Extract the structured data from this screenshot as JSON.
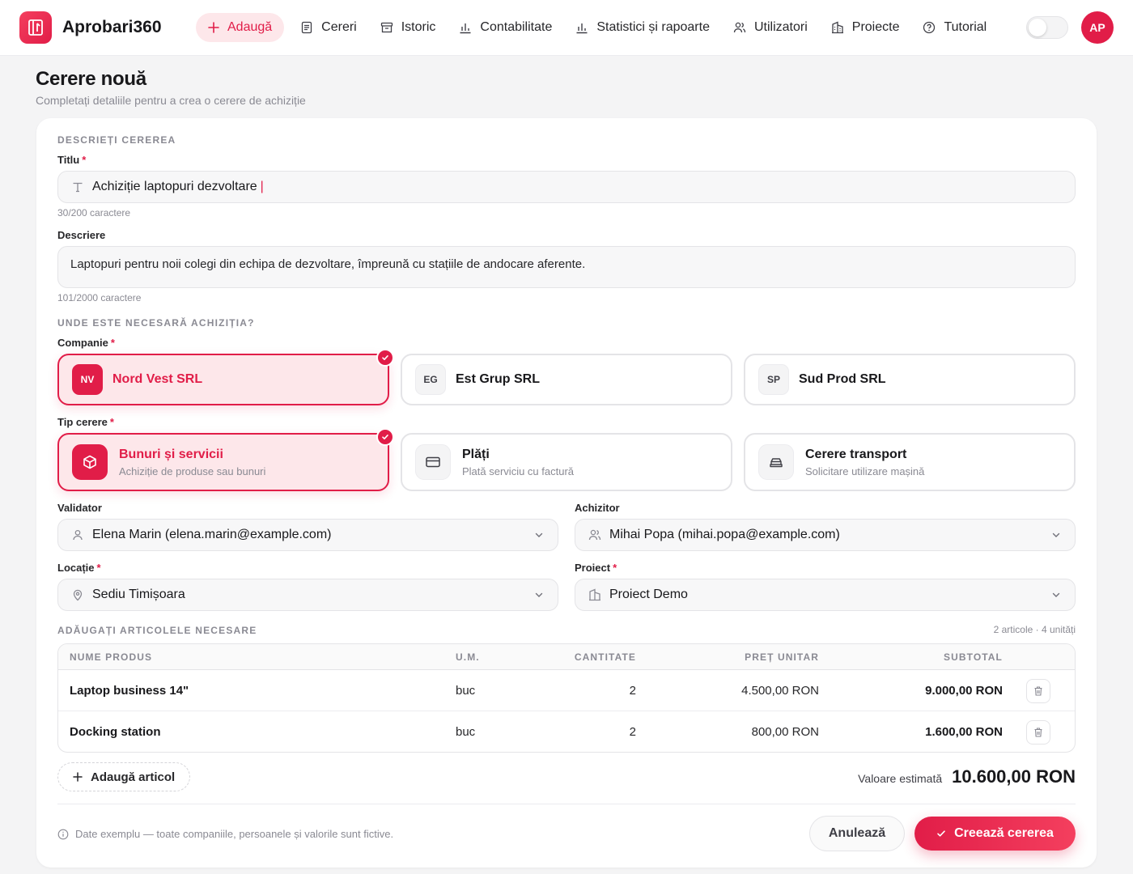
{
  "app": {
    "name": "Aprobari360",
    "user_initials": "AP"
  },
  "nav": {
    "add": "Adaugă",
    "items": [
      {
        "label": "Cereri",
        "icon": "document-icon"
      },
      {
        "label": "Istoric",
        "icon": "archive-icon"
      },
      {
        "label": "Contabilitate",
        "icon": "bar-chart-icon"
      },
      {
        "label": "Statistici și rapoarte",
        "icon": "bar-chart-icon"
      },
      {
        "label": "Utilizatori",
        "icon": "users-icon"
      },
      {
        "label": "Proiecte",
        "icon": "building-icon"
      },
      {
        "label": "Tutorial",
        "icon": "help-circle-icon"
      }
    ],
    "dark_mode": false
  },
  "page": {
    "title": "Cerere nouă",
    "subtitle": "Completați detaliile pentru a crea o cerere de achiziție"
  },
  "form": {
    "describe_section": "DESCRIEȚI CEREREA",
    "title_label": "Titlu",
    "title_value": "Achiziție laptopuri dezvoltare",
    "title_caret": "|",
    "title_counter": "30/200 caractere",
    "description_label": "Descriere",
    "description_value": "Laptopuri pentru noii colegi din echipa de dezvoltare, împreună cu stațiile de andocare aferente.",
    "description_counter": "101/2000 caractere",
    "where_section": "UNDE ESTE NECESARĂ ACHIZIȚIA?",
    "company_label": "Companie",
    "companies": [
      {
        "abbr": "NV",
        "name": "Nord Vest SRL",
        "selected": true
      },
      {
        "abbr": "EG",
        "name": "Est Grup SRL",
        "selected": false
      },
      {
        "abbr": "SP",
        "name": "Sud Prod SRL",
        "selected": false
      }
    ],
    "type_label": "Tip cerere",
    "types": [
      {
        "name": "Bunuri și servicii",
        "desc": "Achiziție de produse sau bunuri",
        "icon": "box-icon",
        "selected": true
      },
      {
        "name": "Plăți",
        "desc": "Plată serviciu cu factură",
        "icon": "credit-card-icon",
        "selected": false
      },
      {
        "name": "Cerere transport",
        "desc": "Solicitare utilizare mașină",
        "icon": "car-icon",
        "selected": false
      }
    ],
    "validator_label": "Validator",
    "validator_value": "Elena Marin (elena.marin@example.com)",
    "buyer_label": "Achizitor",
    "buyer_value": "Mihai Popa (mihai.popa@example.com)",
    "location_label": "Locație",
    "location_value": "Sediu Timișoara",
    "project_label": "Proiect",
    "project_value": "Proiect Demo",
    "required_mark": "*"
  },
  "items": {
    "section": "ADĂUGAȚI ARTICOLELE NECESARE",
    "summary": "2 articole · 4 unități",
    "headers": {
      "name": "NUME PRODUS",
      "unit": "U.M.",
      "qty": "CANTITATE",
      "price": "PREȚ UNITAR",
      "subtotal": "SUBTOTAL"
    },
    "rows": [
      {
        "name": "Laptop business 14\"",
        "unit": "buc",
        "qty": "2",
        "price": "4.500,00 RON",
        "subtotal": "9.000,00 RON"
      },
      {
        "name": "Docking station",
        "unit": "buc",
        "qty": "2",
        "price": "800,00 RON",
        "subtotal": "1.600,00 RON"
      }
    ],
    "add_label": "Adaugă articol",
    "estimate_label": "Valoare estimată",
    "estimate_value": "10.600,00 RON"
  },
  "footer": {
    "note": "Date exemplu — toate companiile, persoanele și valorile sunt fictive.",
    "cancel": "Anulează",
    "submit": "Creează cererea"
  },
  "colors": {
    "accent": "#e11d48",
    "accent_soft": "#fde7ea",
    "background": "#f4f4f5"
  }
}
